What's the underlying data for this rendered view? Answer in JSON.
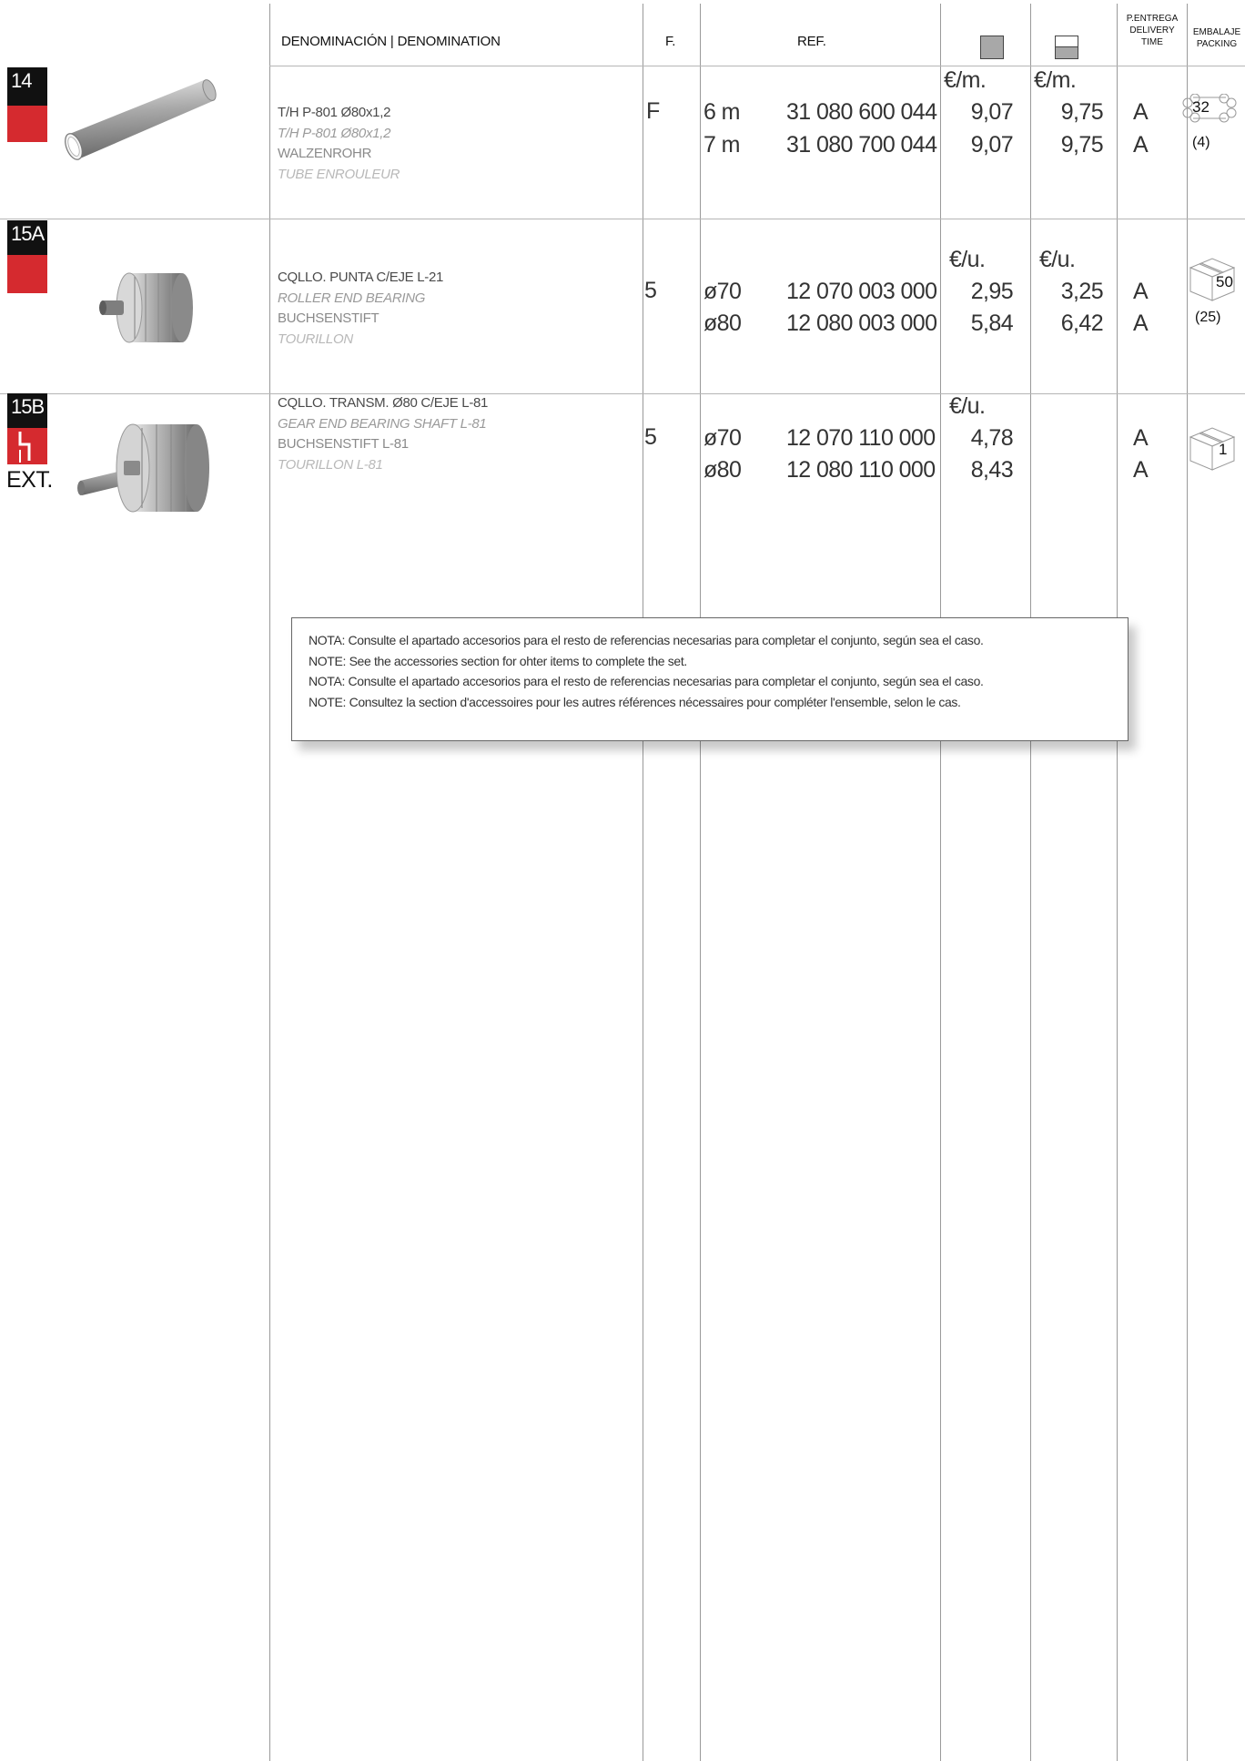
{
  "header": {
    "denomination": "DENOMINACIÓN | DENOMINATION",
    "f": "F.",
    "ref": "REF.",
    "delivery": [
      "P.ENTREGA",
      "DELIVERY",
      "TIME"
    ],
    "packing": [
      "EMBALAJE",
      "PACKING"
    ],
    "icon_price_1": "square-price-icon",
    "icon_price_2": "half-square-price-icon"
  },
  "products": [
    {
      "id": "14",
      "name_es": "T/H P-801 Ø80x1,2",
      "name_en": "T/H P-801 Ø80x1,2",
      "name_de": "WALZENROHR",
      "name_fr": "TUBE ENROULEUR",
      "f": "F",
      "unit1": "€/m.",
      "unit2": "€/m.",
      "rows": [
        {
          "size": "6 m",
          "ref": "31 080 600 044",
          "price1": "9,07",
          "price2": "9,75",
          "delivery": "A"
        },
        {
          "size": "7 m",
          "ref": "31 080 700 044",
          "price1": "9,07",
          "price2": "9,75",
          "delivery": "A"
        }
      ],
      "packing_qty": "32",
      "packing_sub": "(4)",
      "image": "roller-tube-image"
    },
    {
      "id": "15A",
      "name_es": "CQLLO. PUNTA C/EJE L-21",
      "name_en": "ROLLER END BEARING",
      "name_de": "BUCHSENSTIFT",
      "name_fr": "TOURILLON",
      "f": "5",
      "unit1": "€/u.",
      "unit2": "€/u.",
      "rows": [
        {
          "size": "ø70",
          "ref": "12 070 003 000",
          "price1": "2,95",
          "price2": "3,25",
          "delivery": "A"
        },
        {
          "size": "ø80",
          "ref": "12 080 003 000",
          "price1": "5,84",
          "price2": "6,42",
          "delivery": "A"
        }
      ],
      "packing_qty": "50",
      "packing_sub": "(25)",
      "image": "end-bearing-image"
    },
    {
      "id": "15B",
      "ext": "EXT.",
      "name_es": "CQLLO. TRANSM. Ø80 C/EJE L-81",
      "name_en": "GEAR END BEARING SHAFT L-81",
      "name_de": "BUCHSENSTIFT L-81",
      "name_fr": "TOURILLON L-81",
      "f": "5",
      "unit1": "€/u.",
      "rows": [
        {
          "size": "ø70",
          "ref": "12 070 110 000",
          "price1": "4,78",
          "delivery": "A"
        },
        {
          "size": "ø80",
          "ref": "12 080 110 000",
          "price1": "8,43",
          "delivery": "A"
        }
      ],
      "packing_qty": "1",
      "image": "gear-end-bearing-image"
    }
  ],
  "note": [
    "NOTA: Consulte el apartado accesorios para el resto de referencias necesarias para completar el conjunto, según sea el caso.",
    "NOTE: See the accessories section for ohter items to complete the set.",
    "NOTA: Consulte el apartado accesorios para el resto de referencias necesarias para completar el conjunto, según sea el caso.",
    "NOTE: Consultez la section d'accessoires pour les autres références nécessaires pour compléter l'ensemble, selon le cas."
  ]
}
